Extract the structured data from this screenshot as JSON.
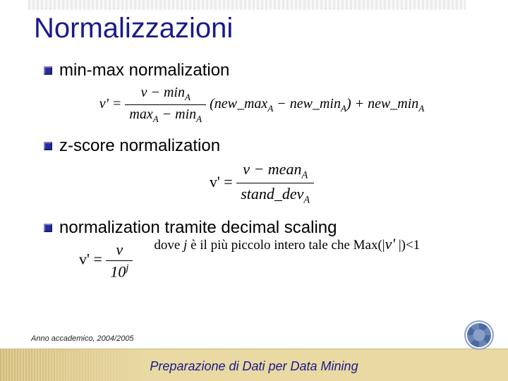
{
  "title": "Normalizzazioni",
  "items": {
    "a": {
      "label": "min-max normalization"
    },
    "b": {
      "label": "z-score normalization"
    },
    "c": {
      "label": "normalization tramite decimal scaling"
    }
  },
  "formulas": {
    "minmax": {
      "lhs": "v' =",
      "num": "v − min",
      "numSub": "A",
      "den1": "max",
      "den1Sub": "A",
      "denMinus": " − min",
      "den2Sub": "A",
      "mid1": "(new_max",
      "mid1Sub": "A",
      "mid2": " − new_min",
      "mid2Sub": "A",
      "mid3": ") + new_min",
      "mid3Sub": "A"
    },
    "zscore": {
      "lhs": "v' =",
      "num": "v − mean",
      "numSub": "A",
      "den": "stand_dev",
      "denSub": "A"
    },
    "decimal": {
      "lhs": "v' =",
      "num": "v",
      "denBase": "10",
      "denExp": "j"
    }
  },
  "caption": {
    "pre": "dove ",
    "j": "j",
    "mid": " è il più piccolo intero tale che Max(|",
    "vp": "v'",
    "post": " |)<1"
  },
  "footer": {
    "year": "Anno accademico, 2004/2005",
    "subtitle": "Preparazione di Dati per Data Mining"
  }
}
